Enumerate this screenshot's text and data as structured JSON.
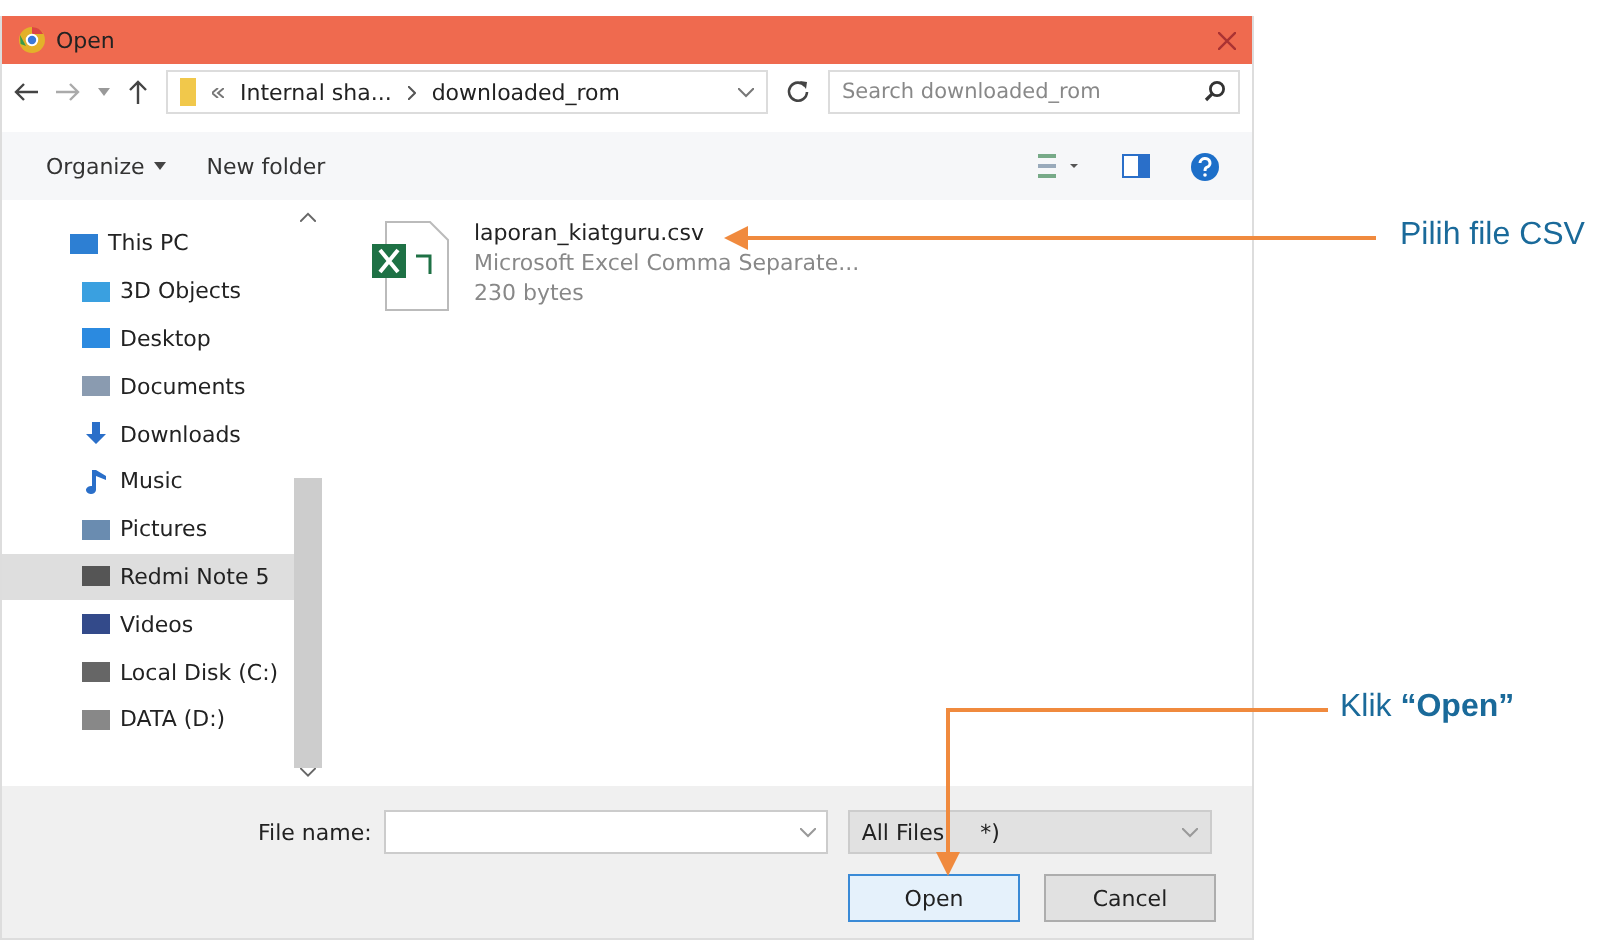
{
  "window": {
    "title": "Open"
  },
  "address": {
    "path": [
      "Internal sha...",
      "downloaded_rom"
    ],
    "search_placeholder": "Search downloaded_rom"
  },
  "toolbar": {
    "organize": "Organize",
    "new_folder": "New folder"
  },
  "sidebar": {
    "items": [
      {
        "label": "This PC",
        "selected": false
      },
      {
        "label": "3D Objects",
        "selected": false
      },
      {
        "label": "Desktop",
        "selected": false
      },
      {
        "label": "Documents",
        "selected": false
      },
      {
        "label": "Downloads",
        "selected": false
      },
      {
        "label": "Music",
        "selected": false
      },
      {
        "label": "Pictures",
        "selected": false
      },
      {
        "label": "Redmi Note 5",
        "selected": true
      },
      {
        "label": "Videos",
        "selected": false
      },
      {
        "label": "Local Disk (C:)",
        "selected": false
      },
      {
        "label": "DATA (D:)",
        "selected": false
      }
    ]
  },
  "files": [
    {
      "name": "laporan_kiatguru.csv",
      "type": "Microsoft Excel Comma Separate...",
      "size": "230 bytes"
    }
  ],
  "footer": {
    "file_name_label": "File name:",
    "filter": [
      "All Files",
      "*)"
    ],
    "open": "Open",
    "cancel": "Cancel"
  },
  "annotations": [
    {
      "kind": "file",
      "text": "Pilih file CSV"
    },
    {
      "kind": "open",
      "text": "Klik **“Open”**"
    }
  ]
}
